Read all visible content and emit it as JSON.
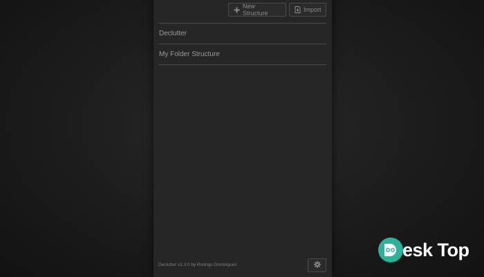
{
  "toolbar": {
    "new_structure_label": "New Structure",
    "import_label": "Import"
  },
  "structures": [
    {
      "label": "Declutter"
    },
    {
      "label": "My Folder Structure"
    }
  ],
  "footer": {
    "version_text": "Declutter v1.3.0 by Rodrigo Dominguez"
  },
  "watermark": {
    "text": "esk Top",
    "brand_color": "#2bb39a"
  },
  "icons": {
    "new": "plus-icon",
    "import": "import-file-icon",
    "settings": "gear-icon"
  }
}
